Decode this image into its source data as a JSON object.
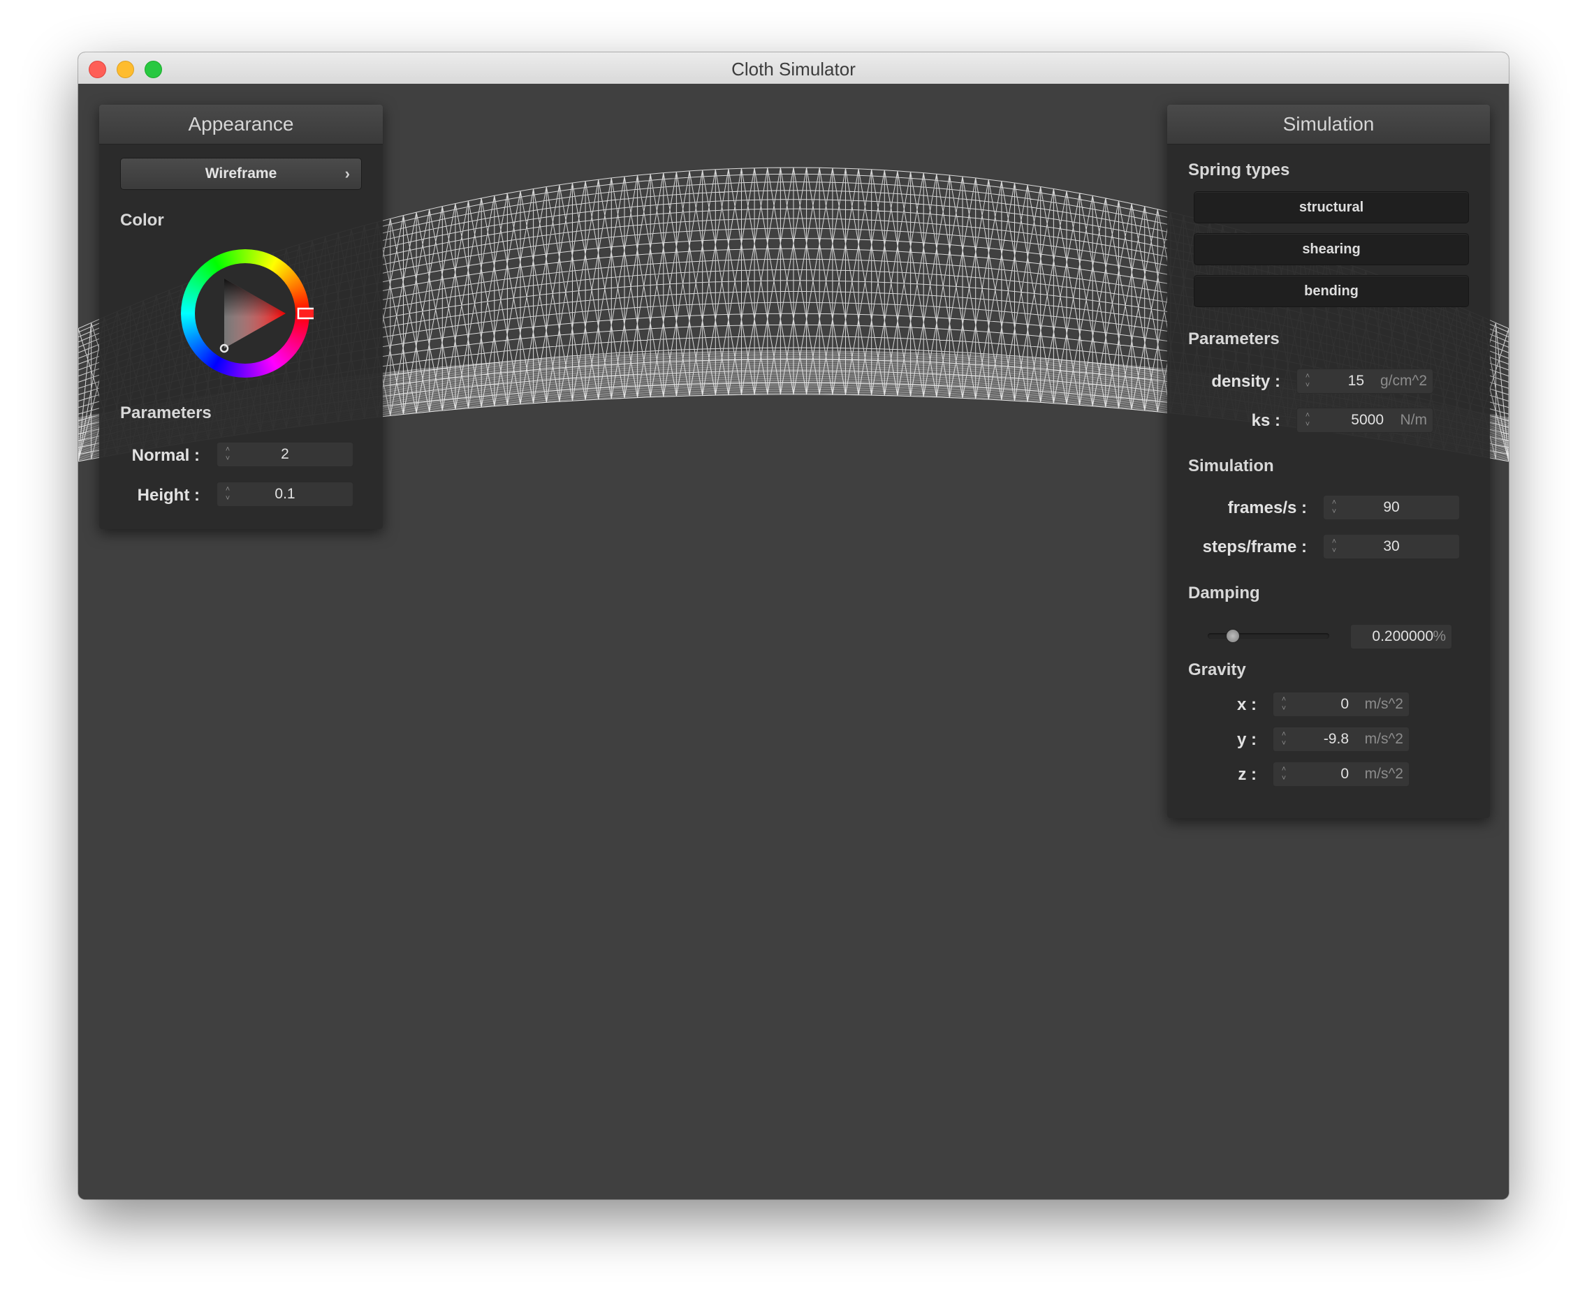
{
  "window": {
    "title": "Cloth Simulator"
  },
  "appearance": {
    "header": "Appearance",
    "render_mode": "Wireframe",
    "color_label": "Color",
    "selected_color": "#ff0000",
    "parameters_label": "Parameters",
    "normal": {
      "label": "Normal :",
      "value": "2"
    },
    "height": {
      "label": "Height :",
      "value": "0.1"
    }
  },
  "simulation": {
    "header": "Simulation",
    "spring_types": {
      "label": "Spring types",
      "buttons": [
        "structural",
        "shearing",
        "bending"
      ]
    },
    "parameters": {
      "label": "Parameters",
      "density": {
        "label": "density :",
        "value": "15",
        "unit": "g/cm^2"
      },
      "ks": {
        "label": "ks :",
        "value": "5000",
        "unit": "N/m"
      }
    },
    "simulation_section": {
      "label": "Simulation",
      "frames_per_second": {
        "label": "frames/s :",
        "value": "90"
      },
      "steps_per_frame": {
        "label": "steps/frame :",
        "value": "30"
      }
    },
    "damping": {
      "label": "Damping",
      "value": "0.200000",
      "unit": "%",
      "slider_fraction": 0.2
    },
    "gravity": {
      "label": "Gravity",
      "x": {
        "label": "x :",
        "value": "0",
        "unit": "m/s^2"
      },
      "y": {
        "label": "y :",
        "value": "-9.8",
        "unit": "m/s^2"
      },
      "z": {
        "label": "z :",
        "value": "0",
        "unit": "m/s^2"
      }
    }
  },
  "icons": {
    "chevron": "›",
    "spin_up": "˄",
    "spin_down": "˅"
  }
}
